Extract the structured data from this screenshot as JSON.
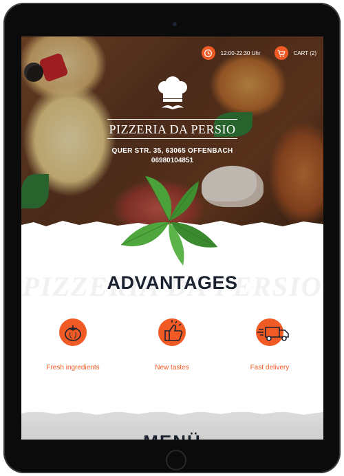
{
  "header": {
    "hours": "12:00-22:30 Uhr",
    "cart_label": "CART (2)"
  },
  "brand": {
    "name": "PIZZERIA DA PERSIO",
    "address": "QUER STR. 35, 63065 OFFENBACH",
    "phone": "06980104851"
  },
  "advantages": {
    "watermark": "PIZZERIA DA PERSIO",
    "title": "ADVANTAGES",
    "items": [
      {
        "icon": "tomato-icon",
        "label": "Fresh ingredients"
      },
      {
        "icon": "thumbs-up-icon",
        "label": "New tastes"
      },
      {
        "icon": "delivery-truck-icon",
        "label": "Fast delivery"
      }
    ]
  },
  "menu_section": {
    "title": "MENÜ"
  },
  "colors": {
    "accent": "#f05a24",
    "heading": "#1b2230",
    "text_light": "#ffffff"
  }
}
